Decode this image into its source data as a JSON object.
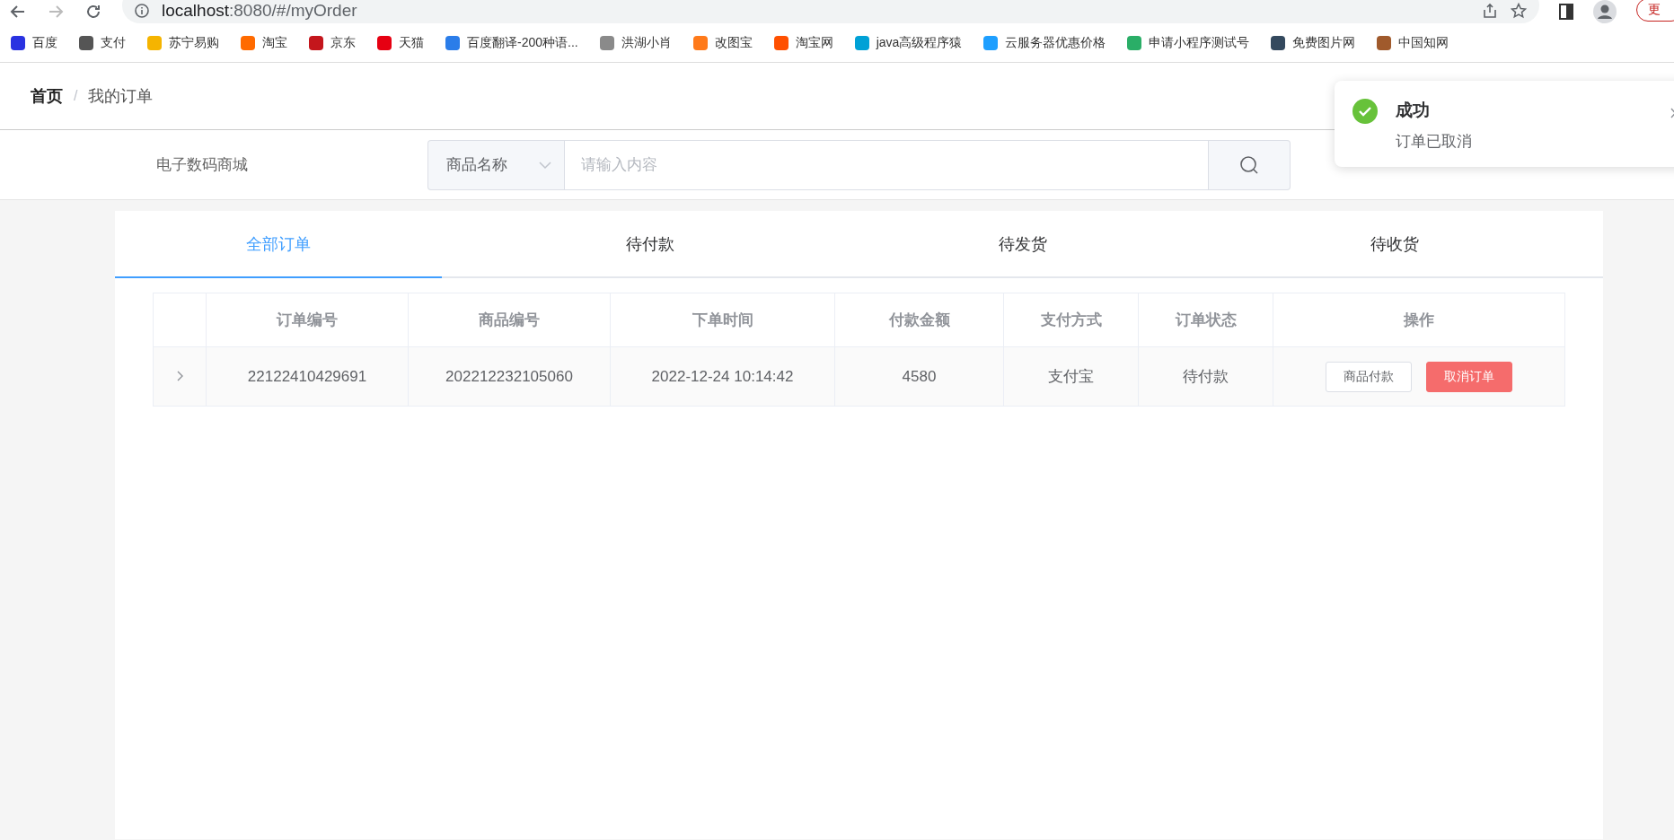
{
  "browser": {
    "url_host": "localhost",
    "url_path": ":8080/#/myOrder",
    "update_button": "更"
  },
  "bookmarks": [
    {
      "label": "百度",
      "color": "#2932e1"
    },
    {
      "label": "支付",
      "color": "#555555"
    },
    {
      "label": "苏宁易购",
      "color": "#f5b400"
    },
    {
      "label": "淘宝",
      "color": "#ff6a00"
    },
    {
      "label": "京东",
      "color": "#c4161c"
    },
    {
      "label": "天猫",
      "color": "#e60012"
    },
    {
      "label": "百度翻译-200种语...",
      "color": "#2b7de9"
    },
    {
      "label": "洪湖小肖",
      "color": "#8a8a8a"
    },
    {
      "label": "改图宝",
      "color": "#ff7a1a"
    },
    {
      "label": "淘宝网",
      "color": "#ff5000"
    },
    {
      "label": "java高级程序猿",
      "color": "#00a1d6"
    },
    {
      "label": "云服务器优惠价格",
      "color": "#1e9fff"
    },
    {
      "label": "申请小程序测试号",
      "color": "#2aae67"
    },
    {
      "label": "免费图片网",
      "color": "#34495e"
    },
    {
      "label": "中国知网",
      "color": "#a05a2c"
    }
  ],
  "breadcrumb": {
    "separator": "/",
    "items": [
      {
        "label": "首页",
        "current": false
      },
      {
        "label": "我的订单",
        "current": true
      }
    ]
  },
  "shop_name": "电子数码商城",
  "search": {
    "category": "商品名称",
    "placeholder": "请输入内容"
  },
  "notification": {
    "title": "成功",
    "message": "订单已取消"
  },
  "tabs": [
    {
      "label": "全部订单",
      "selected": true
    },
    {
      "label": "待付款",
      "selected": false
    },
    {
      "label": "待发货",
      "selected": false
    },
    {
      "label": "待收货",
      "selected": false
    }
  ],
  "table": {
    "columns": [
      "订单编号",
      "商品编号",
      "下单时间",
      "付款金额",
      "支付方式",
      "订单状态",
      "操作"
    ],
    "rows": [
      {
        "expanded": false,
        "cells": [
          "22122410429691",
          "202212232105060",
          "2022-12-24 10:14:42",
          "4580",
          "支付宝",
          "待付款"
        ],
        "actions": [
          {
            "label": "商品付款",
            "kind": "default"
          },
          {
            "label": "取消订单",
            "kind": "danger"
          }
        ]
      }
    ]
  }
}
